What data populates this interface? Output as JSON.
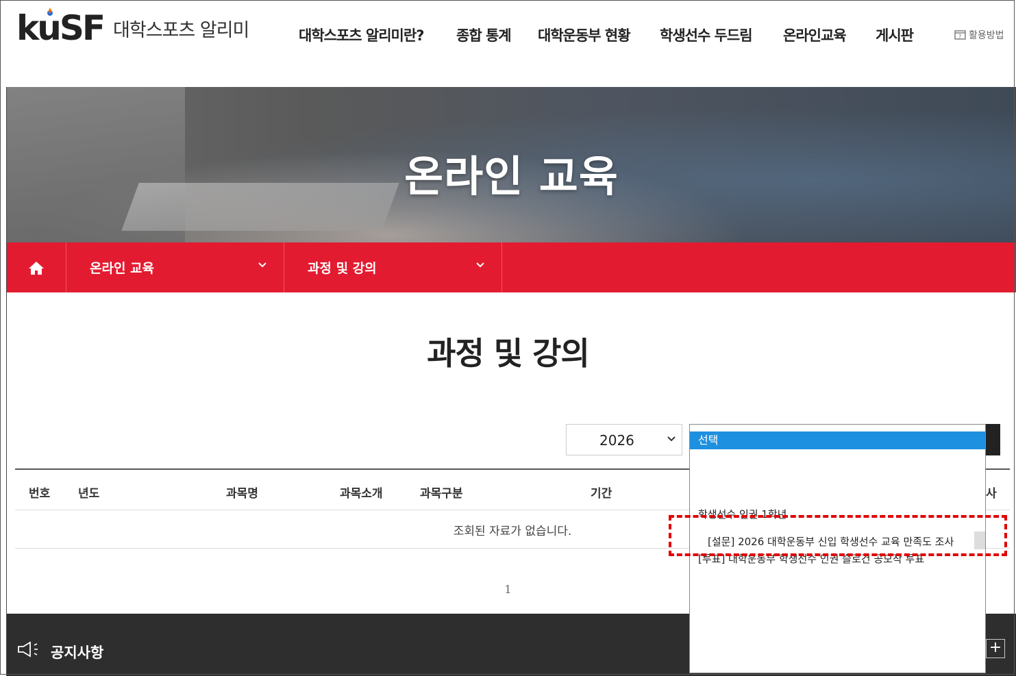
{
  "header": {
    "logo_mark": "kuSF",
    "logo_text": "대학스포츠 알리미",
    "nav": [
      {
        "label": "대학스포츠 알리미란?"
      },
      {
        "label": "종합 통계"
      },
      {
        "label": "대학운동부 현황"
      },
      {
        "label": "학생선수 두드림"
      },
      {
        "label": "온라인교육"
      },
      {
        "label": "게시판"
      }
    ],
    "help_label": "활용방법",
    "help_icon": "guide-icon"
  },
  "hero": {
    "title": "온라인 교육"
  },
  "location": {
    "home_icon": "home-icon",
    "depth1": "온라인 교육",
    "depth2": "과정 및 강의"
  },
  "page": {
    "title": "과정 및 강의"
  },
  "filters": {
    "year": "2026",
    "course_select": {
      "selected": "선택",
      "options": [
        "학생선수 인권 1학년",
        "[설문] 2026 대학운동부 신입 학생선수 교육 만족도 조사",
        "[투표] 대학운동부 학생선수 인권 슬로건 공모작 투표"
      ]
    }
  },
  "table": {
    "columns": [
      "번호",
      "년도",
      "과목명",
      "과목소개",
      "과목구분",
      "기간",
      "사"
    ],
    "empty_message": "조회된 자료가 없습니다."
  },
  "pagination": {
    "current": "1"
  },
  "notice": {
    "title": "공지사항",
    "more": "+"
  },
  "colors": {
    "accent_red": "#e31b30",
    "select_blue": "#1e90e0",
    "dark_footer": "#2e2e2e",
    "highlight_box": "#e00000"
  }
}
